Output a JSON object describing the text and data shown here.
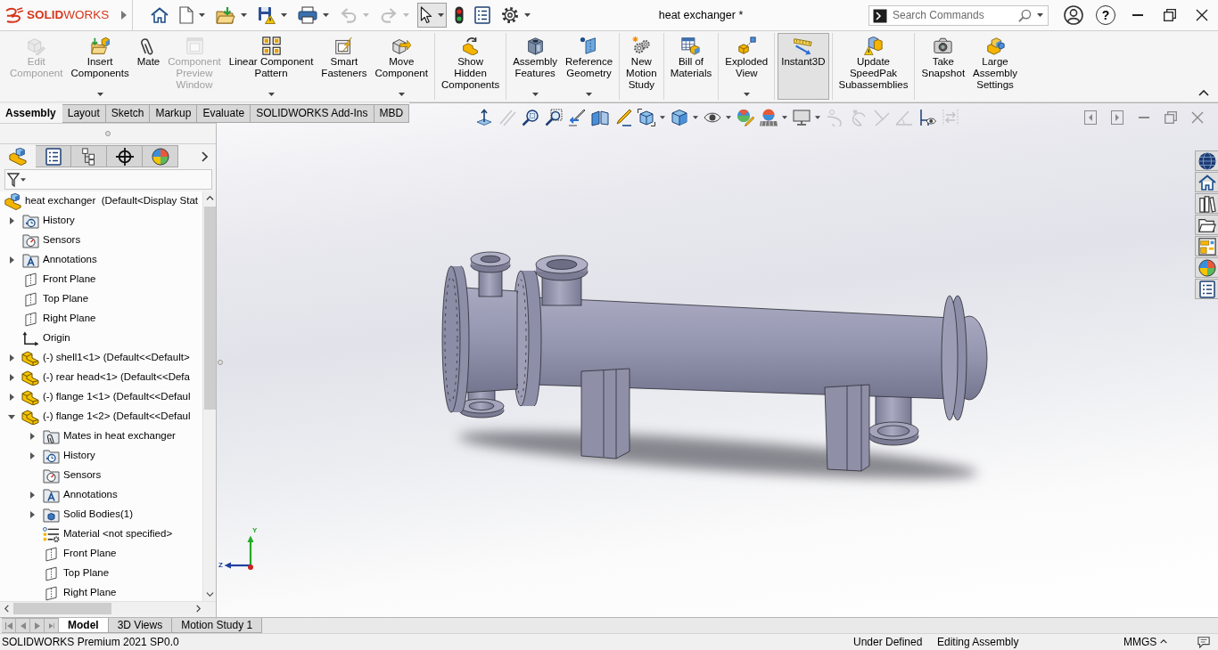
{
  "title_bar": {
    "logo": "**SOLID**WORKS",
    "document_title": "heat exchanger *",
    "search": {
      "placeholder": "Search Commands"
    },
    "help": "?"
  },
  "quick_access": [
    {
      "kind": "home",
      "menu": false,
      "disabled": false,
      "pressed": false
    },
    {
      "kind": "new",
      "menu": true,
      "disabled": false,
      "pressed": false
    },
    {
      "kind": "open",
      "menu": true,
      "disabled": false,
      "pressed": false
    },
    {
      "kind": "save",
      "menu": true,
      "disabled": false,
      "pressed": false
    },
    {
      "kind": "print",
      "menu": true,
      "disabled": false,
      "pressed": false
    },
    {
      "kind": "undo",
      "menu": true,
      "disabled": true,
      "pressed": false
    },
    {
      "kind": "redo",
      "menu": true,
      "disabled": true,
      "pressed": false
    },
    {
      "kind": "select",
      "menu": true,
      "disabled": false,
      "pressed": true
    },
    {
      "kind": "rebuild",
      "menu": false,
      "disabled": false,
      "pressed": false
    },
    {
      "kind": "file-properties",
      "menu": false,
      "disabled": false,
      "pressed": false
    },
    {
      "kind": "options",
      "menu": true,
      "disabled": false,
      "pressed": false
    }
  ],
  "ribbon": {
    "groups": [
      {
        "items": [
          {
            "kind": "edit-component",
            "lines": [
              "Edit",
              "Component"
            ],
            "disabled": true,
            "menu": false,
            "pressed": false
          },
          {
            "kind": "insert-components",
            "lines": [
              "Insert",
              "Components"
            ],
            "disabled": false,
            "menu": true,
            "pressed": false
          },
          {
            "kind": "mate",
            "lines": [
              "Mate"
            ],
            "disabled": false,
            "menu": false,
            "pressed": false
          },
          {
            "kind": "preview-window",
            "lines": [
              "Component",
              "Preview",
              "Window"
            ],
            "disabled": true,
            "menu": false,
            "pressed": false
          },
          {
            "kind": "linear-pattern",
            "lines": [
              "Linear Component",
              "Pattern"
            ],
            "disabled": false,
            "menu": true,
            "pressed": false
          },
          {
            "kind": "smart-fasteners",
            "lines": [
              "Smart",
              "Fasteners"
            ],
            "disabled": false,
            "menu": false,
            "pressed": false
          },
          {
            "kind": "move-component",
            "lines": [
              "Move",
              "Component"
            ],
            "disabled": false,
            "menu": true,
            "pressed": false
          }
        ]
      },
      {
        "items": [
          {
            "kind": "show-hidden",
            "lines": [
              "Show",
              "Hidden",
              "Components"
            ],
            "disabled": false,
            "menu": false,
            "pressed": false
          }
        ]
      },
      {
        "items": [
          {
            "kind": "assembly-features",
            "lines": [
              "Assembly",
              "Features"
            ],
            "disabled": false,
            "menu": true,
            "pressed": false
          },
          {
            "kind": "reference-geometry",
            "lines": [
              "Reference",
              "Geometry"
            ],
            "disabled": false,
            "menu": true,
            "pressed": false
          }
        ]
      },
      {
        "items": [
          {
            "kind": "motion-study",
            "lines": [
              "New",
              "Motion",
              "Study"
            ],
            "disabled": false,
            "menu": false,
            "pressed": false
          }
        ]
      },
      {
        "items": [
          {
            "kind": "bill-of-materials",
            "lines": [
              "Bill of",
              "Materials"
            ],
            "disabled": false,
            "menu": false,
            "pressed": false
          }
        ]
      },
      {
        "items": [
          {
            "kind": "exploded-view",
            "lines": [
              "Exploded",
              "View"
            ],
            "disabled": false,
            "menu": true,
            "pressed": false
          }
        ]
      },
      {
        "items": [
          {
            "kind": "instant3d",
            "lines": [
              "Instant3D"
            ],
            "disabled": false,
            "menu": false,
            "pressed": true
          }
        ]
      },
      {
        "items": [
          {
            "kind": "speedpak",
            "lines": [
              "Update",
              "SpeedPak",
              "Subassemblies"
            ],
            "disabled": false,
            "menu": false,
            "pressed": false
          }
        ]
      },
      {
        "items": [
          {
            "kind": "snapshot",
            "lines": [
              "Take",
              "Snapshot"
            ],
            "disabled": false,
            "menu": false,
            "pressed": false
          },
          {
            "kind": "large-assembly",
            "lines": [
              "Large",
              "Assembly",
              "Settings"
            ],
            "disabled": false,
            "menu": false,
            "pressed": false
          }
        ]
      }
    ]
  },
  "command_tabs": [
    {
      "label": "Assembly",
      "selected": true
    },
    {
      "label": "Layout",
      "selected": false
    },
    {
      "label": "Sketch",
      "selected": false
    },
    {
      "label": "Markup",
      "selected": false
    },
    {
      "label": "Evaluate",
      "selected": false
    },
    {
      "label": "SOLIDWORKS Add-Ins",
      "selected": false
    },
    {
      "label": "MBD",
      "selected": false
    }
  ],
  "view_toolbar": [
    {
      "kind": "normal-to",
      "disabled": false,
      "menu": false
    },
    {
      "kind": "lines",
      "disabled": true,
      "menu": false
    },
    {
      "kind": "zoom-fit",
      "disabled": false,
      "menu": false
    },
    {
      "kind": "zoom-area",
      "disabled": false,
      "menu": false
    },
    {
      "kind": "previous-view",
      "disabled": false,
      "menu": false
    },
    {
      "kind": "section-view",
      "disabled": false,
      "menu": false
    },
    {
      "kind": "annotation-view",
      "disabled": false,
      "menu": false
    },
    {
      "kind": "view-orientation",
      "disabled": false,
      "menu": true
    },
    {
      "kind": "display-style",
      "disabled": false,
      "menu": true
    },
    {
      "kind": "hide-show",
      "disabled": false,
      "menu": true
    },
    {
      "kind": "appearance",
      "disabled": false,
      "menu": false
    },
    {
      "kind": "scene",
      "disabled": false,
      "menu": true
    },
    {
      "kind": "view-settings",
      "disabled": false,
      "menu": true
    },
    {
      "kind": "curve",
      "disabled": true,
      "menu": false
    },
    {
      "kind": "curve-star",
      "disabled": true,
      "menu": false
    },
    {
      "kind": "angle",
      "disabled": true,
      "menu": false
    },
    {
      "kind": "angle-arc",
      "disabled": true,
      "menu": false
    },
    {
      "kind": "bracket-eye",
      "disabled": false,
      "menu": false
    },
    {
      "kind": "swap",
      "disabled": true,
      "menu": false
    }
  ],
  "panel_tabs": [
    {
      "kind": "feature-tree",
      "selected": true
    },
    {
      "kind": "properties",
      "selected": false
    },
    {
      "kind": "configurations",
      "selected": false
    },
    {
      "kind": "dimxpert",
      "selected": false
    },
    {
      "kind": "appearance",
      "selected": false
    }
  ],
  "tree": {
    "label": "heat exchanger  (Default<Display Stat",
    "kind": "assembly",
    "children": [
      {
        "label": "History",
        "kind": "history",
        "expanded": false
      },
      {
        "label": "Sensors",
        "kind": "sensors"
      },
      {
        "label": "Annotations",
        "kind": "annotations",
        "expanded": false
      },
      {
        "label": "Front Plane",
        "kind": "plane"
      },
      {
        "label": "Top Plane",
        "kind": "plane"
      },
      {
        "label": "Right Plane",
        "kind": "plane"
      },
      {
        "label": "Origin",
        "kind": "origin"
      },
      {
        "label": "(-) shell1<1> (Default<<Default>",
        "kind": "part",
        "expanded": false
      },
      {
        "label": "(-) rear head<1> (Default<<Defa",
        "kind": "part",
        "expanded": false
      },
      {
        "label": "(-) flange 1<1> (Default<<Defaul",
        "kind": "part",
        "expanded": false
      },
      {
        "label": "(-) flange 1<2> (Default<<Defaul",
        "kind": "part",
        "expanded": true,
        "children": [
          {
            "label": "Mates in heat exchanger",
            "kind": "mates",
            "expanded": false
          },
          {
            "label": "History",
            "kind": "history",
            "expanded": false
          },
          {
            "label": "Sensors",
            "kind": "sensors"
          },
          {
            "label": "Annotations",
            "kind": "annotations",
            "expanded": false
          },
          {
            "label": "Solid Bodies(1)",
            "kind": "bodies",
            "expanded": false
          },
          {
            "label": "Material <not specified>",
            "kind": "material"
          },
          {
            "label": "Front Plane",
            "kind": "plane"
          },
          {
            "label": "Top Plane",
            "kind": "plane"
          },
          {
            "label": "Right Plane",
            "kind": "plane"
          }
        ]
      }
    ]
  },
  "triad": {
    "y_label": "Y",
    "z_label": "Z"
  },
  "bottom_tabs": [
    {
      "label": "Model",
      "selected": true
    },
    {
      "label": "3D Views",
      "selected": false
    },
    {
      "label": "Motion Study 1",
      "selected": false
    }
  ],
  "status_bar": {
    "product": "SOLIDWORKS Premium 2021 SP0.0",
    "state": "Under Defined",
    "mode": "Editing Assembly",
    "units": "MMGS"
  }
}
